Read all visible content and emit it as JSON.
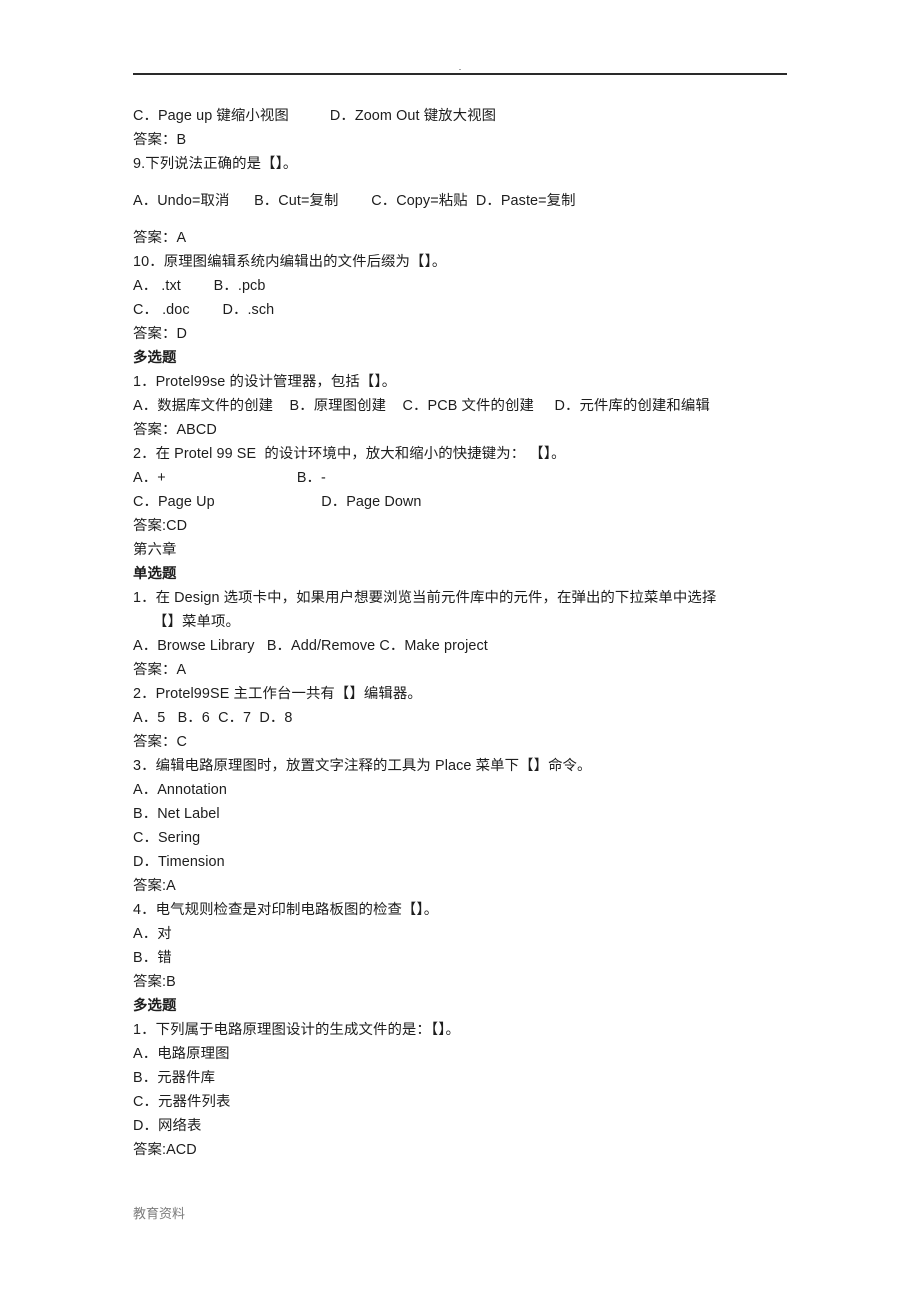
{
  "header": {
    "mark": ".",
    "rule_color": "#2a2a2a"
  },
  "footer": {
    "watermark": "教育资料",
    "color": "#7b7b7b"
  },
  "document": {
    "lines": [
      {
        "id": "q8-options-cd",
        "text": "C．Page up 键缩小视图          D．Zoom Out 键放大视图",
        "style": "normal"
      },
      {
        "id": "q8-answer",
        "text": "答案：B",
        "style": "normal"
      },
      {
        "id": "q9-stem",
        "text": "9.下列说法正确的是【】。",
        "style": "normal"
      },
      {
        "id": "q9-options",
        "text": "A．Undo=取消      B．Cut=复制        C．Copy=粘贴  D．Paste=复制",
        "style": "spaced"
      },
      {
        "id": "q9-answer",
        "text": "答案：A",
        "style": "normal"
      },
      {
        "id": "q10-stem",
        "text": "10．原理图编辑系统内编辑出的文件后缀为【】。",
        "style": "normal"
      },
      {
        "id": "q10-options-ab",
        "text": "A． .txt        B．.pcb",
        "style": "normal"
      },
      {
        "id": "q10-options-cd",
        "text": "C． .doc        D．.sch",
        "style": "normal"
      },
      {
        "id": "q10-answer",
        "text": "答案：D",
        "style": "normal"
      },
      {
        "id": "heading-multi-1",
        "text": "多选题",
        "style": "bold"
      },
      {
        "id": "m1-stem",
        "text": "1．Protel99se 的设计管理器，包括【】。",
        "style": "normal"
      },
      {
        "id": "m1-options",
        "text": "A．数据库文件的创建    B．原理图创建    C．PCB 文件的创建     D．元件库的创建和编辑",
        "style": "normal"
      },
      {
        "id": "m1-answer",
        "text": "答案：ABCD",
        "style": "normal"
      },
      {
        "id": "m2-stem",
        "text": "2．在 Protel 99 SE  的设计环境中，放大和缩小的快捷键为： 【】。",
        "style": "normal"
      },
      {
        "id": "m2-options-ab",
        "text": "A．+                                B．-",
        "style": "normal"
      },
      {
        "id": "m2-options-cd",
        "text": "C．Page Up                          D．Page Down",
        "style": "normal"
      },
      {
        "id": "m2-answer",
        "text": "答案:CD",
        "style": "normal"
      },
      {
        "id": "chapter-6",
        "text": "第六章",
        "style": "normal"
      },
      {
        "id": "heading-single-1",
        "text": "单选题",
        "style": "bold"
      },
      {
        "id": "s1-stem",
        "text": "1．在 Design 选项卡中，如果用户想要浏览当前元件库中的元件，在弹出的下拉菜单中选择",
        "style": "normal"
      },
      {
        "id": "s1-stem-cont",
        "text": "【】菜单项。",
        "style": "indent"
      },
      {
        "id": "s1-options",
        "text": "A．Browse Library   B．Add/Remove C．Make project",
        "style": "normal"
      },
      {
        "id": "s1-answer",
        "text": "答案：A",
        "style": "normal"
      },
      {
        "id": "s2-stem",
        "text": "2．Protel99SE 主工作台一共有【】编辑器。",
        "style": "normal"
      },
      {
        "id": "s2-options",
        "text": "A．5   B．6  C．7  D．8",
        "style": "normal"
      },
      {
        "id": "s2-answer",
        "text": "答案：C",
        "style": "normal"
      },
      {
        "id": "s3-stem",
        "text": "3．编辑电路原理图时，放置文字注释的工具为 Place 菜单下【】命令。",
        "style": "normal"
      },
      {
        "id": "s3-option-a",
        "text": "A．Annotation",
        "style": "normal"
      },
      {
        "id": "s3-option-b",
        "text": "B．Net Label",
        "style": "normal"
      },
      {
        "id": "s3-option-c",
        "text": "C．Sering",
        "style": "normal"
      },
      {
        "id": "s3-option-d",
        "text": "D．Timension",
        "style": "normal"
      },
      {
        "id": "s3-answer",
        "text": "答案:A",
        "style": "normal"
      },
      {
        "id": "s4-stem",
        "text": "4．电气规则检查是对印制电路板图的检查【】。",
        "style": "normal"
      },
      {
        "id": "s4-option-a",
        "text": "A．对",
        "style": "normal"
      },
      {
        "id": "s4-option-b",
        "text": "B．错",
        "style": "normal"
      },
      {
        "id": "s4-answer",
        "text": "答案:B",
        "style": "normal"
      },
      {
        "id": "heading-multi-2",
        "text": "多选题",
        "style": "bold"
      },
      {
        "id": "m3-stem",
        "text": "1．下列属于电路原理图设计的生成文件的是：【】。",
        "style": "normal"
      },
      {
        "id": "m3-option-a",
        "text": "A．电路原理图",
        "style": "normal"
      },
      {
        "id": "m3-option-b",
        "text": "B．元器件库",
        "style": "normal"
      },
      {
        "id": "m3-option-c",
        "text": "C．元器件列表",
        "style": "normal"
      },
      {
        "id": "m3-option-d",
        "text": "D．网络表",
        "style": "normal"
      },
      {
        "id": "m3-answer",
        "text": "答案:ACD",
        "style": "normal"
      }
    ]
  }
}
